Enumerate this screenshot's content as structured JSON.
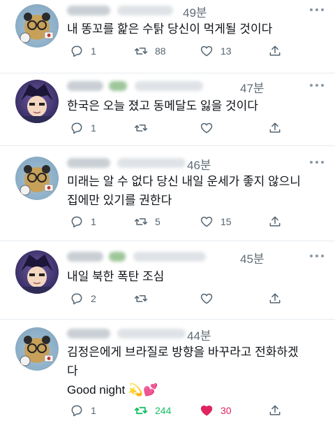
{
  "tweets": [
    {
      "avatar": "bear-avatar",
      "time": "49분",
      "text_lines": [
        "내 똥꼬를 핥은 수탉 당신이 먹게될 것이다"
      ],
      "reply_count": "1",
      "retweet_count": "88",
      "like_count": "13",
      "retweeted": false,
      "liked": false
    },
    {
      "avatar": "anime-avatar",
      "time": "47분",
      "text_lines": [
        "한국은 오늘 졌고 동메달도 잃을 것이다"
      ],
      "reply_count": "1",
      "retweet_count": "",
      "like_count": "",
      "retweeted": false,
      "liked": false
    },
    {
      "avatar": "bear-avatar",
      "time": "46분",
      "text_lines": [
        "미래는 알 수 없다 당신 내일 운세가 좋지 않으니",
        "집에만 있기를 권한다"
      ],
      "reply_count": "1",
      "retweet_count": "5",
      "like_count": "15",
      "retweeted": false,
      "liked": false
    },
    {
      "avatar": "anime-avatar",
      "time": "45분",
      "text_lines": [
        "내일 북한 폭탄 조심"
      ],
      "reply_count": "2",
      "retweet_count": "",
      "like_count": "",
      "retweeted": false,
      "liked": false
    },
    {
      "avatar": "bear-avatar",
      "time": "44분",
      "text_lines": [
        "김정은에게 브라질로 방향을 바꾸라고 전화하겠",
        "다",
        "Good night 💫💕"
      ],
      "reply_count": "1",
      "retweet_count": "244",
      "like_count": "30",
      "retweeted": true,
      "liked": true
    }
  ],
  "icons": {
    "reply": "reply-icon",
    "retweet": "retweet-icon",
    "like": "heart-icon",
    "share": "share-icon",
    "more": "more-icon"
  },
  "colors": {
    "retweet_active": "#17bf63",
    "like_active": "#e0245e",
    "muted": "#536471"
  }
}
